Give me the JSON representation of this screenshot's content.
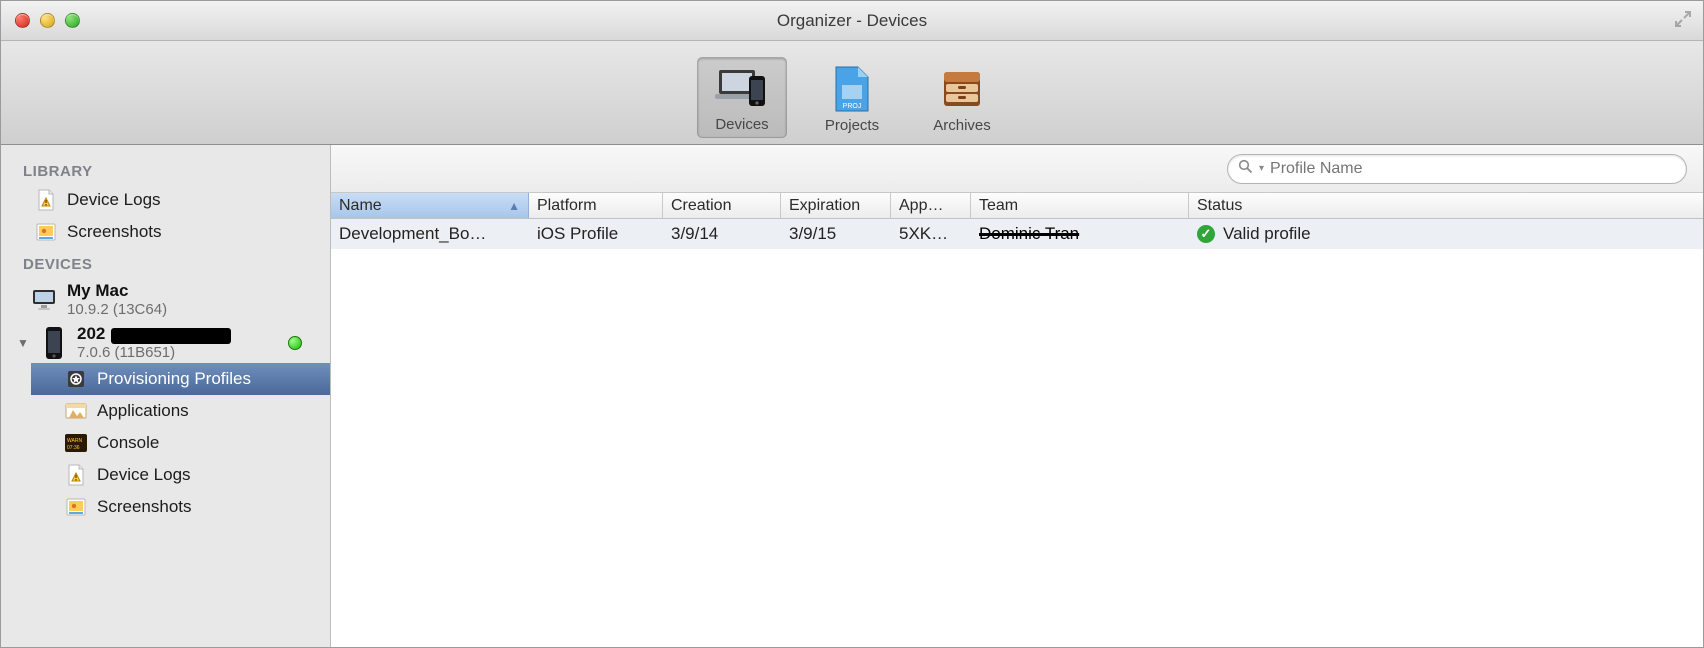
{
  "window": {
    "title": "Organizer - Devices"
  },
  "toolbar": {
    "tabs": [
      {
        "label": "Devices",
        "selected": true
      },
      {
        "label": "Projects",
        "selected": false
      },
      {
        "label": "Archives",
        "selected": false
      }
    ]
  },
  "search": {
    "placeholder": "Profile Name"
  },
  "sidebar": {
    "library_head": "LIBRARY",
    "library": [
      {
        "label": "Device Logs",
        "icon": "warning-doc"
      },
      {
        "label": "Screenshots",
        "icon": "screenshot"
      }
    ],
    "devices_head": "DEVICES",
    "mac": {
      "name": "My Mac",
      "sub": "10.9.2 (13C64)"
    },
    "phone": {
      "name_prefix": "202",
      "sub": "7.0.6 (11B651)",
      "online": true,
      "items": [
        {
          "label": "Provisioning Profiles",
          "icon": "profile",
          "selected": true
        },
        {
          "label": "Applications",
          "icon": "apps"
        },
        {
          "label": "Console",
          "icon": "console"
        },
        {
          "label": "Device Logs",
          "icon": "warning-doc"
        },
        {
          "label": "Screenshots",
          "icon": "screenshot"
        }
      ]
    }
  },
  "table": {
    "columns": [
      "Name",
      "Platform",
      "Creation",
      "Expiration",
      "App…",
      "Team",
      "Status"
    ],
    "sort_index": 0,
    "rows": [
      {
        "name": "Development_Bo…",
        "platform": "iOS Profile",
        "creation": "3/9/14",
        "expiration": "3/9/15",
        "app": "5XK…",
        "team": "Dominic Tran",
        "status": "Valid profile"
      }
    ]
  }
}
